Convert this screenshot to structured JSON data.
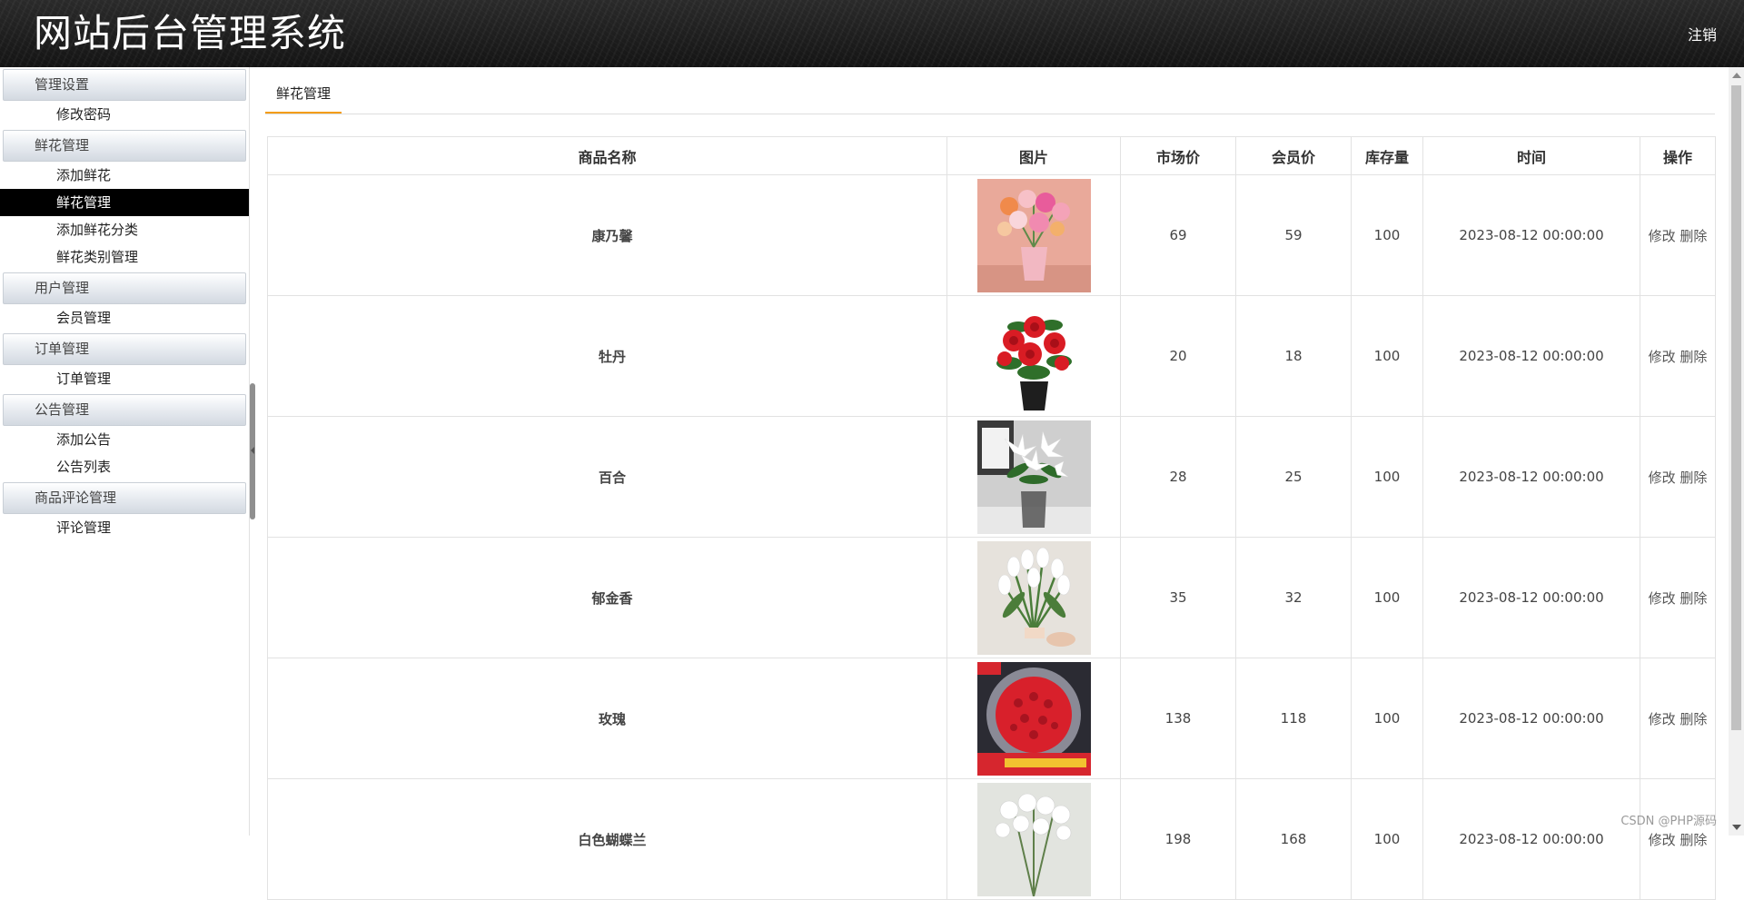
{
  "header": {
    "title": "网站后台管理系统",
    "logout": "注销"
  },
  "sidebar": {
    "groups": [
      {
        "label": "管理设置",
        "items": [
          "修改密码"
        ]
      },
      {
        "label": "鲜花管理",
        "items": [
          "添加鲜花",
          "鲜花管理",
          "添加鲜花分类",
          "鲜花类别管理"
        ]
      },
      {
        "label": "用户管理",
        "items": [
          "会员管理"
        ]
      },
      {
        "label": "订单管理",
        "items": [
          "订单管理"
        ]
      },
      {
        "label": "公告管理",
        "items": [
          "添加公告",
          "公告列表"
        ]
      },
      {
        "label": "商品评论管理",
        "items": [
          "评论管理"
        ]
      }
    ],
    "active": "鲜花管理"
  },
  "main": {
    "tab": "鲜花管理",
    "columns": [
      "商品名称",
      "图片",
      "市场价",
      "会员价",
      "库存量",
      "时间",
      "操作"
    ],
    "edit_label": "修改",
    "delete_label": "删除",
    "rows": [
      {
        "name": "康乃馨",
        "image": "carnation-bouquet-photo",
        "market_price": "69",
        "member_price": "59",
        "stock": "100",
        "time": "2023-08-12 00:00:00"
      },
      {
        "name": "牡丹",
        "image": "peony-pot-photo",
        "market_price": "20",
        "member_price": "18",
        "stock": "100",
        "time": "2023-08-12 00:00:00"
      },
      {
        "name": "百合",
        "image": "lily-vase-photo",
        "market_price": "28",
        "member_price": "25",
        "stock": "100",
        "time": "2023-08-12 00:00:00"
      },
      {
        "name": "郁金香",
        "image": "white-tulip-bouquet-photo",
        "market_price": "35",
        "member_price": "32",
        "stock": "100",
        "time": "2023-08-12 00:00:00"
      },
      {
        "name": "玫瑰",
        "image": "red-rose-bouquet-photo",
        "market_price": "138",
        "member_price": "118",
        "stock": "100",
        "time": "2023-08-12 00:00:00"
      },
      {
        "name": "白色蝴蝶兰",
        "image": "white-orchid-photo",
        "market_price": "198",
        "member_price": "168",
        "stock": "100",
        "time": "2023-08-12 00:00:00"
      }
    ]
  },
  "watermark": "CSDN @PHP源码",
  "colors": {
    "header_bg": "#1a1a1a",
    "active_bg": "#000000",
    "tab_underline": "#f39c12"
  }
}
